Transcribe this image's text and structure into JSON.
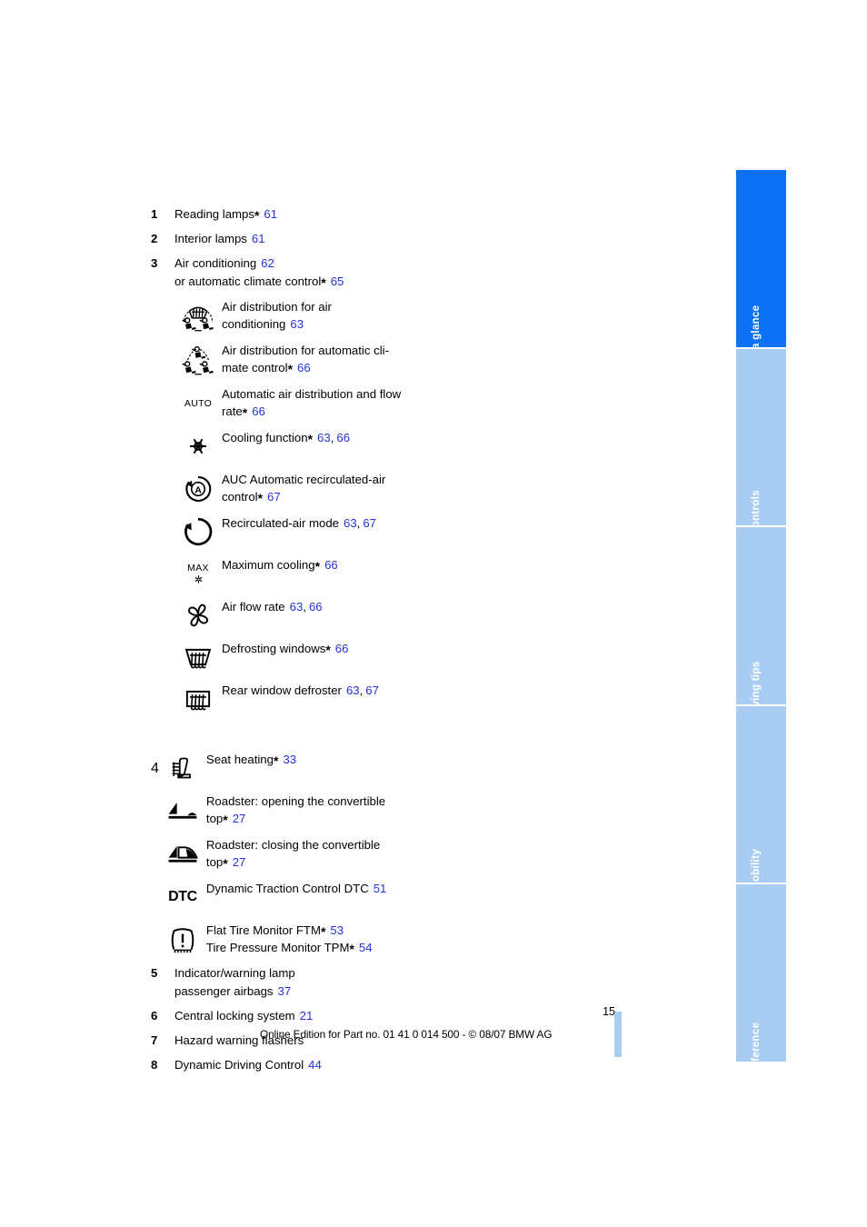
{
  "page": {
    "number": "15",
    "footer": "Online Edition for Part no. 01 41 0 014 500 - © 08/07 BMW AG",
    "accent_active": "#0b72f5",
    "accent_inactive": "#a9cdf2",
    "link_color": "#2233d8"
  },
  "tabs": [
    {
      "label": "At a glance",
      "state": "active"
    },
    {
      "label": "Controls",
      "state": "inactive"
    },
    {
      "label": "Driving tips",
      "state": "inactive"
    },
    {
      "label": "Mobility",
      "state": "inactive"
    },
    {
      "label": "Reference",
      "state": "inactive"
    }
  ],
  "entries": [
    {
      "num": "1",
      "text": "Reading lamps",
      "star": "*",
      "pages": [
        "61"
      ]
    },
    {
      "num": "2",
      "text": "Interior lamps",
      "star": "",
      "pages": [
        "61"
      ]
    },
    {
      "num": "3",
      "text": "Air conditioning",
      "star": "",
      "pages": [
        "62"
      ],
      "line2": "or automatic climate control",
      "line2_star": "*",
      "line2_pages": [
        "65"
      ]
    }
  ],
  "climate_icons": [
    {
      "icon": "air-distribution-ac-icon",
      "text_line1": "Air distribution for air",
      "text_line2": "conditioning",
      "star": "",
      "pages": [
        "63"
      ]
    },
    {
      "icon": "air-distribution-auto-climate-icon",
      "text_line1": "Air distribution for automatic cli-",
      "text_line2": "mate control",
      "star": "*",
      "pages": [
        "66"
      ]
    },
    {
      "icon": "auto-label-icon",
      "icon_label": "AUTO",
      "text_line1": "Automatic air distribution and flow",
      "text_line2": "rate",
      "star": "*",
      "pages": [
        "66"
      ]
    },
    {
      "icon": "snowflake-icon",
      "text_line1": "Cooling function",
      "text_line2": "",
      "star": "*",
      "pages": [
        "63",
        "66"
      ]
    },
    {
      "icon": "auc-recirculation-icon",
      "text_line1": "AUC Automatic recirculated-air",
      "text_line2": "control",
      "star": "*",
      "pages": [
        "67"
      ]
    },
    {
      "icon": "recirculated-air-icon",
      "text_line1": "Recirculated-air mode",
      "text_line2": "",
      "star": "",
      "pages": [
        "63",
        "67"
      ]
    },
    {
      "icon": "max-cooling-icon",
      "icon_label": "MAX",
      "text_line1": "Maximum cooling",
      "text_line2": "",
      "star": "*",
      "pages": [
        "66"
      ]
    },
    {
      "icon": "fan-icon",
      "text_line1": "Air flow rate",
      "text_line2": "",
      "star": "",
      "pages": [
        "63",
        "66"
      ]
    },
    {
      "icon": "windshield-defrost-icon",
      "text_line1": "Defrosting windows",
      "text_line2": "",
      "star": "*",
      "pages": [
        "66"
      ]
    },
    {
      "icon": "rear-window-defroster-icon",
      "text_line1": "Rear window defroster",
      "text_line2": "",
      "star": "",
      "pages": [
        "63",
        "67"
      ]
    }
  ],
  "group4": {
    "num": "4",
    "icons": [
      {
        "icon": "seat-heating-icon",
        "text_line1": "Seat heating",
        "text_line2": "",
        "star": "*",
        "pages": [
          "33"
        ]
      },
      {
        "icon": "convertible-top-open-icon",
        "text_line1": "Roadster: opening the convertible",
        "text_line2": "top",
        "star": "*",
        "pages": [
          "27"
        ]
      },
      {
        "icon": "convertible-top-close-icon",
        "text_line1": "Roadster: closing the convertible",
        "text_line2": "top",
        "star": "*",
        "pages": [
          "27"
        ]
      },
      {
        "icon": "dtc-icon",
        "icon_label": "DTC",
        "text_line1": "Dynamic Traction Control DTC",
        "text_line2": "",
        "star": "",
        "pages": [
          "51"
        ]
      },
      {
        "icon": "tire-monitor-icon",
        "text_line1": "Flat Tire Monitor FTM",
        "star": "*",
        "pages": [
          "53"
        ],
        "text_line2": "Tire Pressure Monitor TPM",
        "star2": "*",
        "pages2": [
          "54"
        ]
      }
    ]
  },
  "entries_tail": [
    {
      "num": "5",
      "text": "Indicator/warning lamp",
      "star": "",
      "pages": [],
      "line2": "passenger airbags",
      "line2_star": "",
      "line2_pages": [
        "37"
      ]
    },
    {
      "num": "6",
      "text": "Central locking system",
      "star": "",
      "pages": [
        "21"
      ]
    },
    {
      "num": "7",
      "text": "Hazard warning flashers",
      "star": "",
      "pages": []
    },
    {
      "num": "8",
      "text": "Dynamic Driving Control",
      "star": "",
      "pages": [
        "44"
      ]
    }
  ]
}
